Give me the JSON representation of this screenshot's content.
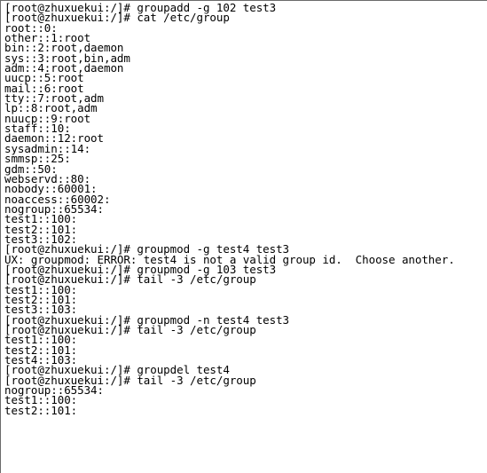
{
  "terminal": {
    "background_color": "#ffffff",
    "text_color": "#000000",
    "border_color": "#6b6b6b",
    "prompt": "[root@zhuxuekui:/]# ",
    "hostname": "zhuxuekui",
    "user": "root",
    "cwd": "/",
    "lines": [
      "[root@zhuxuekui:/]# groupadd -g 102 test3",
      "[root@zhuxuekui:/]# cat /etc/group",
      "root::0:",
      "other::1:root",
      "bin::2:root,daemon",
      "sys::3:root,bin,adm",
      "adm::4:root,daemon",
      "uucp::5:root",
      "mail::6:root",
      "tty::7:root,adm",
      "lp::8:root,adm",
      "nuucp::9:root",
      "staff::10:",
      "daemon::12:root",
      "sysadmin::14:",
      "smmsp::25:",
      "gdm::50:",
      "webservd::80:",
      "nobody::60001:",
      "noaccess::60002:",
      "nogroup::65534:",
      "test1::100:",
      "test2::101:",
      "test3::102:",
      "[root@zhuxuekui:/]# groupmod -g test4 test3",
      "UX: groupmod: ERROR: test4 is not a valid group id.  Choose another.",
      "[root@zhuxuekui:/]# groupmod -g 103 test3",
      "[root@zhuxuekui:/]# tail -3 /etc/group",
      "test1::100:",
      "test2::101:",
      "test3::103:",
      "[root@zhuxuekui:/]# groupmod -n test4 test3",
      "[root@zhuxuekui:/]# tail -3 /etc/group",
      "test1::100:",
      "test2::101:",
      "test4::103:",
      "[root@zhuxuekui:/]# groupdel test4",
      "[root@zhuxuekui:/]# tail -3 /etc/group",
      "nogroup::65534:",
      "test1::100:",
      "test2::101:"
    ]
  }
}
